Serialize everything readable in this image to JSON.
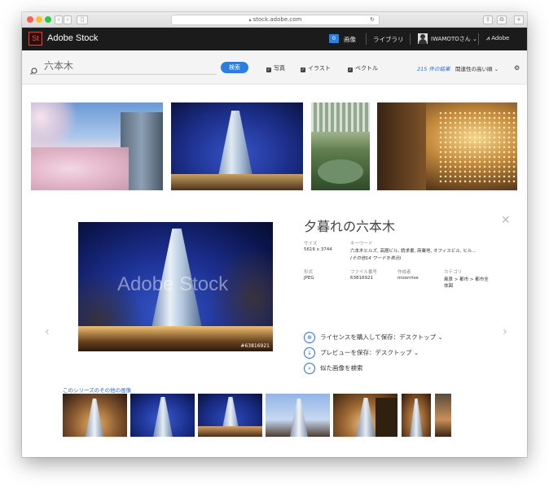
{
  "browser": {
    "url": "stock.adobe.com",
    "traffic_lights": [
      "#fe5f57",
      "#febc2e",
      "#28c840"
    ]
  },
  "topnav": {
    "logo": "St",
    "brand": "Adobe Stock",
    "cart_count": "0",
    "images_label": "画像",
    "library_label": "ライブラリ",
    "user_label": "IWAMOTOさん ⌄",
    "adobe_label": "Adobe"
  },
  "search": {
    "query": "六本木",
    "button_label": "検索",
    "filters": [
      "写真",
      "イラスト",
      "ベクトル"
    ],
    "results_count": "215 件の結果",
    "sort_label": "関連性の高い順 ⌄"
  },
  "detail": {
    "title": "夕暮れの六本木",
    "size_label": "サイズ",
    "size_value": "5616 x 3744",
    "keywords_label": "キーワード",
    "keywords_value": "六本木ヒルズ, 高層ビル, 請求書, 商業地, オフィスビル, ヒル...",
    "keywords_more": "(その他14 ワードを表示)",
    "format_label": "形式",
    "format_value": "JPEG",
    "file_label": "ファイル番号",
    "file_value": "63816921",
    "author_label": "作成者",
    "author_value": "moonrise",
    "category_label": "カテゴリ",
    "category_value_1": "風景 > 都市 > 都市全",
    "category_value_2": "体図",
    "image_id_overlay": "#63816921",
    "watermark": "Adobe Stock",
    "actions": {
      "license_save": "ライセンスを購入して保存：デスクトップ ⌄",
      "preview_save": "プレビューを保存：デスクトップ ⌄",
      "find_similar": "似た画像を検索"
    }
  },
  "series": {
    "label": "このシリーズのその他の画像"
  },
  "colors": {
    "accent": "#2b7de0",
    "topnav_bg": "#1b1b1b",
    "logo_red": "#ff3b30"
  }
}
